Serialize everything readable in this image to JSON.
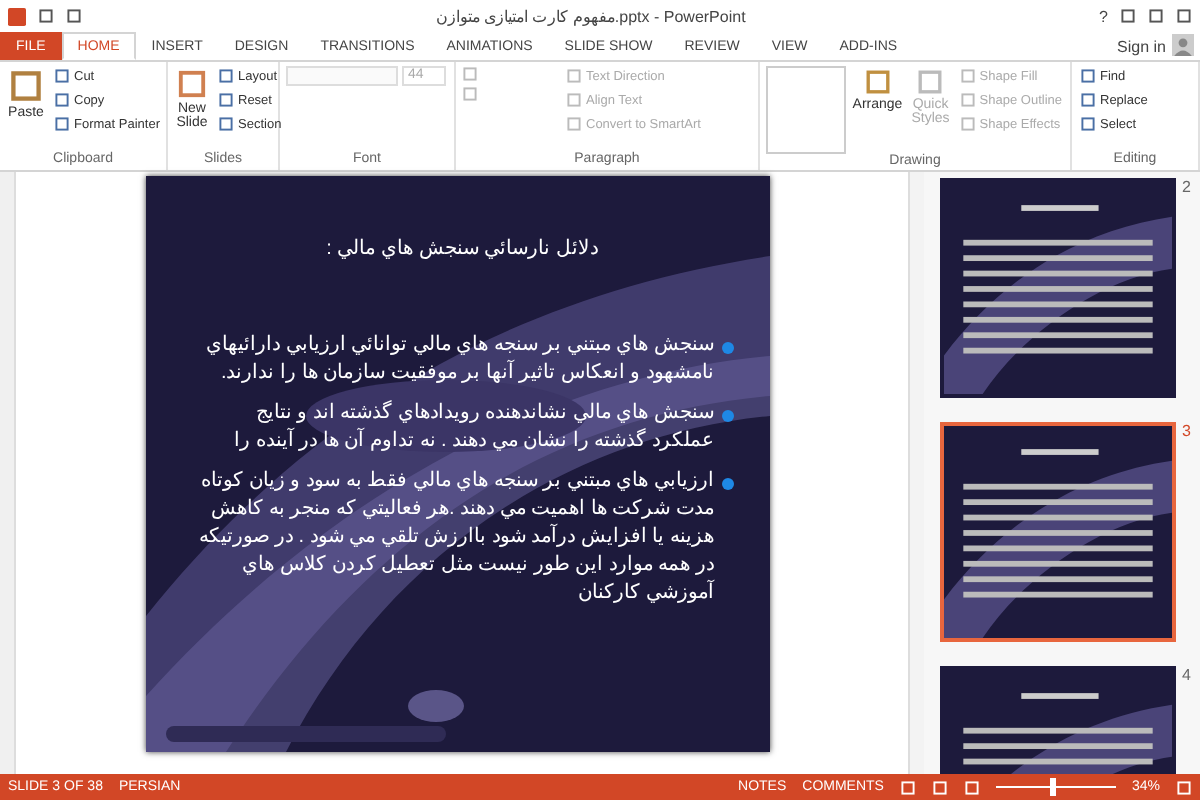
{
  "title_bar": {
    "title": "مفهوم کارت امتیازی متوازن.pptx - PowerPoint",
    "help": "?"
  },
  "tabs": [
    {
      "label": "FILE",
      "kind": "file",
      "selected": false
    },
    {
      "label": "HOME",
      "kind": "tab",
      "selected": true
    },
    {
      "label": "INSERT",
      "kind": "tab",
      "selected": false
    },
    {
      "label": "DESIGN",
      "kind": "tab",
      "selected": false
    },
    {
      "label": "TRANSITIONS",
      "kind": "tab",
      "selected": false
    },
    {
      "label": "ANIMATIONS",
      "kind": "tab",
      "selected": false
    },
    {
      "label": "SLIDE SHOW",
      "kind": "tab",
      "selected": false
    },
    {
      "label": "REVIEW",
      "kind": "tab",
      "selected": false
    },
    {
      "label": "VIEW",
      "kind": "tab",
      "selected": false
    },
    {
      "label": "ADD-INS",
      "kind": "tab",
      "selected": false
    }
  ],
  "account": "Sign in",
  "ribbon": {
    "clipboard": {
      "label": "Clipboard",
      "paste": "Paste",
      "items": [
        {
          "label": "Cut",
          "disabled": false
        },
        {
          "label": "Copy",
          "disabled": false
        },
        {
          "label": "Format Painter",
          "disabled": false
        }
      ]
    },
    "slides": {
      "label": "Slides",
      "new_slide": "New Slide",
      "items": [
        {
          "label": "Layout",
          "disabled": false
        },
        {
          "label": "Reset",
          "disabled": false
        },
        {
          "label": "Section",
          "disabled": false
        }
      ]
    },
    "font": {
      "label": "Font",
      "size": "44"
    },
    "paragraph": {
      "label": "Paragraph",
      "items": [
        {
          "label": "Text Direction",
          "disabled": true
        },
        {
          "label": "Align Text",
          "disabled": true
        },
        {
          "label": "Convert to SmartArt",
          "disabled": true
        }
      ]
    },
    "drawing": {
      "label": "Drawing",
      "arrange": "Arrange",
      "quick_styles": "Quick Styles",
      "items": [
        {
          "label": "Shape Fill",
          "disabled": true
        },
        {
          "label": "Shape Outline",
          "disabled": true
        },
        {
          "label": "Shape Effects",
          "disabled": true
        }
      ]
    },
    "editing": {
      "label": "Editing",
      "items": [
        {
          "label": "Find",
          "disabled": false
        },
        {
          "label": "Replace",
          "disabled": false
        },
        {
          "label": "Select",
          "disabled": false
        }
      ]
    }
  },
  "slide": {
    "title": "دلائل نارسائي سنجش هاي مالي :",
    "bullets": [
      "سنجش هاي مبتني بر سنجه هاي مالي توانائي ارزيابي دارائيهاي نامشهود و انعكاس تاثير آنها بر موفقيت سازمان ها را ندارند.",
      "سنجش هاي مالي نشاندهنده رويدادهاي گذشته اند و نتايج عملكرد گذشته را نشان مي دهند . نه تداوم آن ها در آينده را",
      "ارزيابي هاي مبتني بر سنجه هاي مالي فقط به سود و زيان كوتاه مدت شركت ها اهميت مي دهند .هر فعاليتي كه منجر به كاهش هزينه يا افزايش درآمد شود باارزش تلقي مي شود . در صورتيكه در همه موارد اين طور نيست مثل تعطيل كردن كلاس هاي آموزشي كاركنان"
    ]
  },
  "thumbnails": [
    {
      "number": "2",
      "selected": false
    },
    {
      "number": "3",
      "selected": true
    },
    {
      "number": "4",
      "selected": false
    }
  ],
  "status_bar": {
    "slide": "SLIDE 3 OF 38",
    "language": "PERSIAN",
    "notes": "NOTES",
    "comments": "COMMENTS",
    "zoom": "34%",
    "level": 0.45
  }
}
